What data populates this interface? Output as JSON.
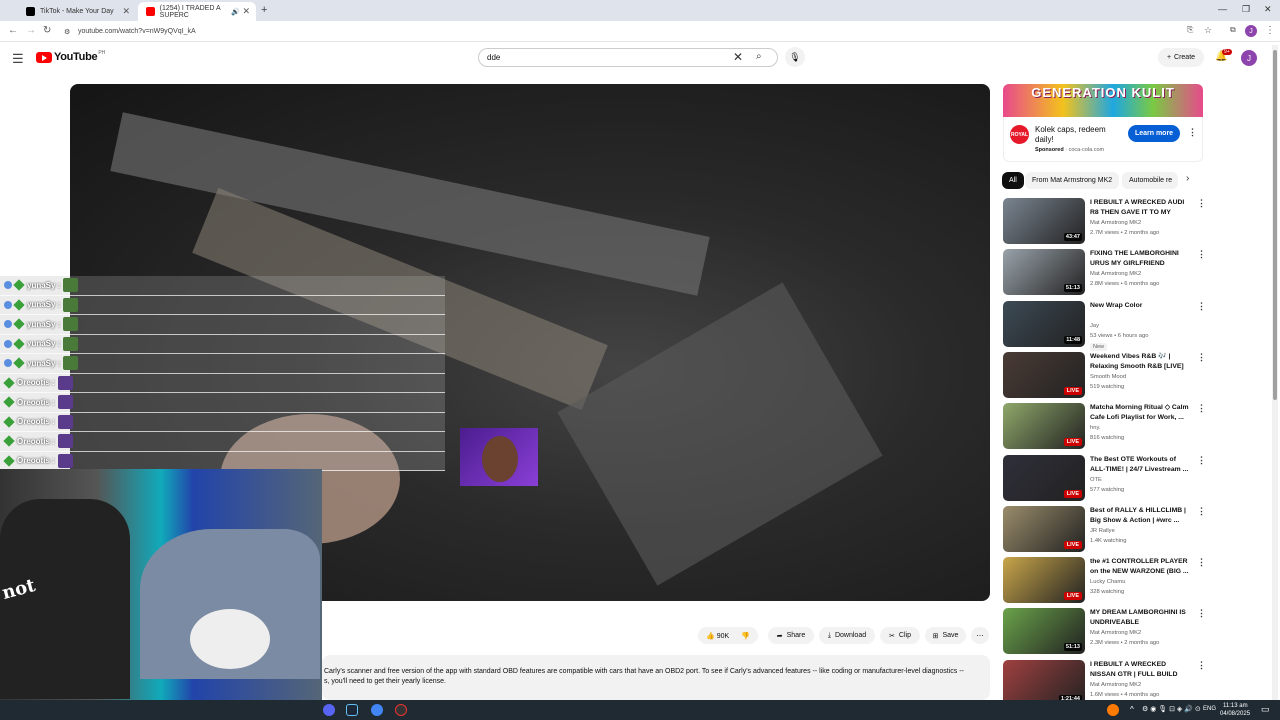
{
  "browser": {
    "tabs": [
      {
        "title": "TikTok - Make Your Day"
      },
      {
        "title": "(1254) I TRADED A SUPERC"
      }
    ],
    "new_tab": "+",
    "url": "youtube.com/watch?v=nW9yQVqI_kA"
  },
  "youtube": {
    "logo_text": "YouTube",
    "region": "PH",
    "search_value": "dde",
    "create_label": "Create",
    "notif_count": "9+",
    "avatar_letter": "J"
  },
  "chat": {
    "rows": [
      {
        "user": "yunaSy"
      },
      {
        "user": "yunaSy"
      },
      {
        "user": "yunaSy"
      },
      {
        "user": "yunaSy"
      },
      {
        "user": "yunaSy"
      },
      {
        "user": "Oreootis"
      },
      {
        "user": "Oreootis"
      },
      {
        "user": "Oreootis"
      },
      {
        "user": "Oreootis"
      },
      {
        "user": "Oreootis"
      }
    ]
  },
  "cam": {
    "shirt_text": "not"
  },
  "actions": {
    "likes": "90K",
    "share": "Share",
    "download": "Download",
    "clip": "Clip",
    "save": "Save"
  },
  "description": {
    "line1": "Carly's scanner and free version of the app with standard OBD features are compatible with cars that have an OBD2 port. To see if Carly's advanced features -- like coding or manufacturer-level diagnostics --",
    "line2": "s, you'll need to get their yearly license."
  },
  "ad": {
    "banner_text": "GENERATION KULIT",
    "brand_badge": "ROYAL",
    "title": "Kolek caps, redeem daily!",
    "sponsored": "Sponsored",
    "domain": "coca-cola.com",
    "cta": "Learn more"
  },
  "chips": [
    "All",
    "From Mat Armstrong MK2",
    "Automobile re"
  ],
  "recommendations": [
    {
      "title": "I REBUILT A WRECKED AUDI R8 THEN GAVE IT TO MY FRIEND",
      "channel": "Mat Armstrong MK2",
      "meta": "2.7M views • 2 months ago",
      "duration": "43:47",
      "live": false,
      "isnew": false,
      "color": "#7a8591"
    },
    {
      "title": "FIXING THE LAMBORGHINI URUS MY GIRLFRIEND BROKE",
      "channel": "Mat Armstrong MK2",
      "meta": "2.8M views • 6 months ago",
      "duration": "51:13",
      "live": false,
      "isnew": false,
      "color": "#9aa3ab"
    },
    {
      "title": "New Wrap Color",
      "channel": "Jay",
      "meta": "53 views • 6 hours ago",
      "duration": "11:48",
      "live": false,
      "isnew": true,
      "newlabel": "New",
      "color": "#3c4a55"
    },
    {
      "title": "Weekend Vibes R&B 🎶 | Relaxing Smooth R&B [LIVE]",
      "channel": "Smooth Mood",
      "meta": "519 watching",
      "duration": "LIVE",
      "live": true,
      "isnew": false,
      "color": "#4a3b35"
    },
    {
      "title": "Matcha Morning Ritual ◇ Calm Cafe Lofi Playlist for Work, ...",
      "channel": "hny.",
      "meta": "816 watching",
      "duration": "LIVE",
      "live": true,
      "isnew": false,
      "color": "#8fa86a"
    },
    {
      "title": "The Best OTE Workouts of ALL-TIME! | 24/7 Livestream ...",
      "channel": "OTE",
      "meta": "577 watching",
      "duration": "LIVE",
      "live": true,
      "isnew": false,
      "color": "#2f2f3a"
    },
    {
      "title": "Best of RALLY & HILLCLIMB | Big Show & Action | #wrc ...",
      "channel": "JR Rallye",
      "meta": "1.4K watching",
      "duration": "LIVE",
      "live": true,
      "isnew": false,
      "color": "#9b8d6b"
    },
    {
      "title": "the #1 CONTROLLER PLAYER on the NEW WARZONE (BIG ...",
      "channel": "Lucky Chamu",
      "meta": "328 watching",
      "duration": "LIVE",
      "live": true,
      "isnew": false,
      "color": "#c9a64a"
    },
    {
      "title": "MY DREAM LAMBORGHINI IS UNDRIVEABLE",
      "channel": "Mat Armstrong MK2",
      "meta": "2.3M views • 2 months ago",
      "duration": "51:13",
      "live": false,
      "isnew": false,
      "color": "#6aa34a"
    },
    {
      "title": "I REBUILT A WRECKED NISSAN GTR | FULL BUILD",
      "channel": "Mat Armstrong MK2",
      "meta": "1.6M views • 4 months ago",
      "duration": "1:21:44",
      "live": false,
      "isnew": false,
      "color": "#a04040"
    }
  ],
  "taskbar": {
    "lang": "ENG",
    "time": "11:13 am",
    "date": "04/08/2025"
  }
}
